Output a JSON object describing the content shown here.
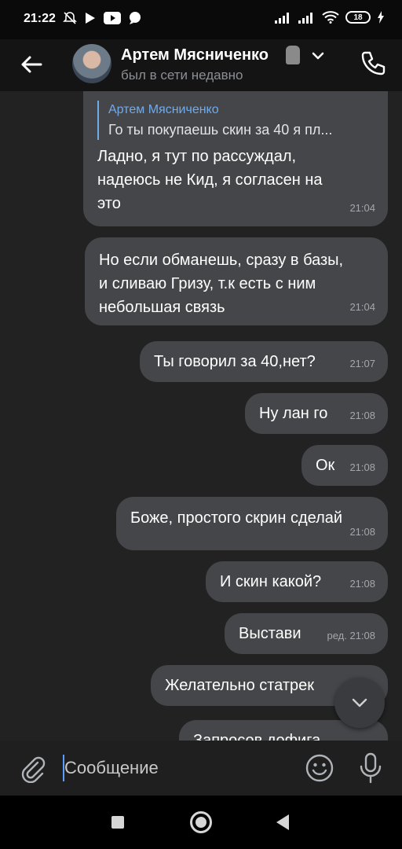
{
  "status_bar": {
    "time": "21:22",
    "battery": "18"
  },
  "header": {
    "name": "Артем Мясниченко",
    "status": "был в сети недавно"
  },
  "messages": [
    {
      "quote_author": "Артем Мясниченко",
      "quote_text": "Го ты покупаешь скин за 40 я пл...",
      "lines": [
        "Ладно, я тут по рассуждал,",
        "надеюсь не Кид, я согласен на",
        "это"
      ],
      "time": "21:04"
    },
    {
      "lines": [
        "Но если обманешь, сразу в базы,",
        "и сливаю Гризу, т.к есть с ним",
        "небольшая связь"
      ],
      "time": "21:04"
    },
    {
      "lines": [
        "Ты говорил за 40,нет?"
      ],
      "time": "21:07"
    },
    {
      "lines": [
        "Ну лан го"
      ],
      "time": "21:08"
    },
    {
      "lines": [
        "Ок"
      ],
      "time": "21:08"
    },
    {
      "lines": [
        "Боже, простого скрин сделай"
      ],
      "time": "21:08"
    },
    {
      "lines": [
        "И скин какой?"
      ],
      "time": "21:08"
    },
    {
      "lines": [
        "Выстави"
      ],
      "time": "ред. 21:08"
    },
    {
      "lines": [
        "Желательно статрек"
      ],
      "time": ""
    },
    {
      "lines": [
        "Запросов дофига"
      ],
      "time": ""
    }
  ],
  "input": {
    "placeholder": "Сообщение"
  },
  "icons": {
    "back": "arrow-left-icon",
    "call": "phone-icon",
    "attach": "paperclip-icon",
    "emoji": "smile-icon",
    "mic": "microphone-icon",
    "scroll_down": "chevron-down-icon"
  },
  "colors": {
    "bubble": "#454649",
    "chat_bg": "#222222",
    "accent": "#71aaeb"
  }
}
